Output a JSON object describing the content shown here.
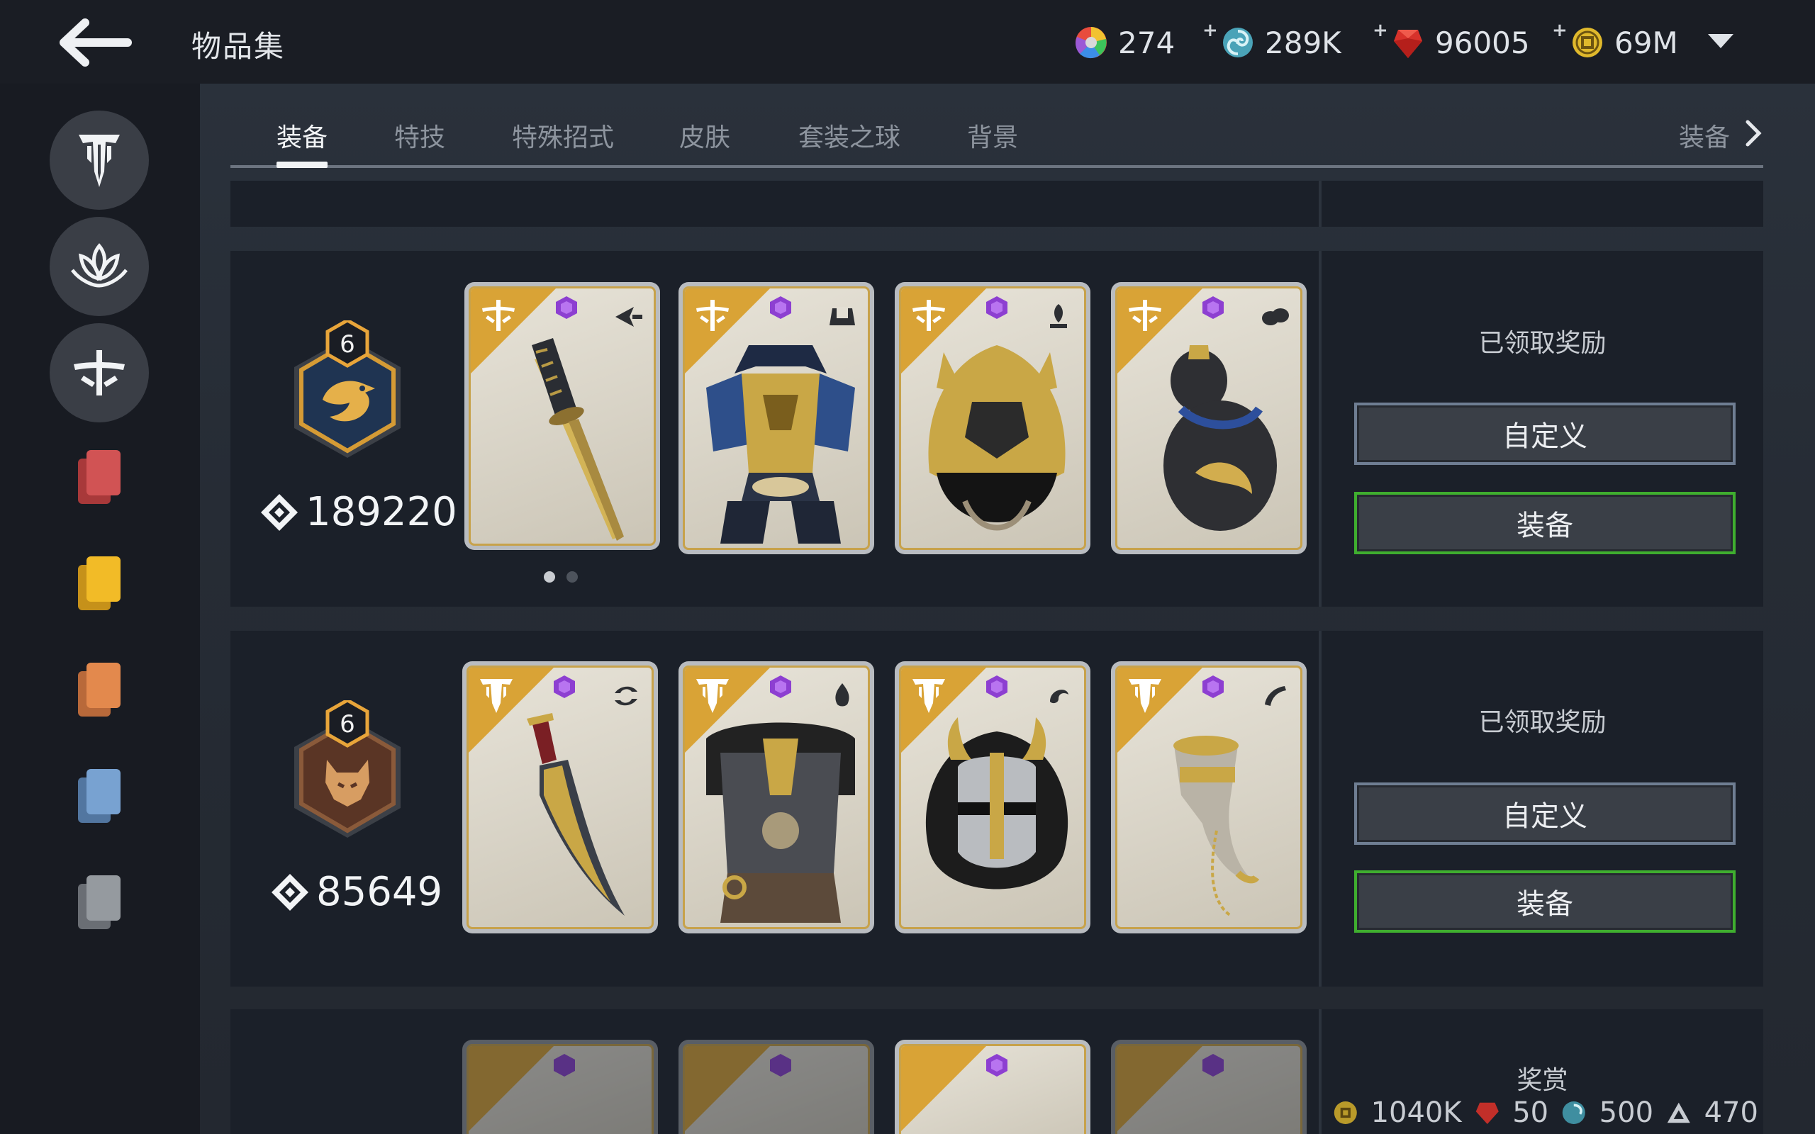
{
  "header": {
    "title": "物品集",
    "currencies": [
      {
        "name": "rainbow-orb",
        "value": "274",
        "has_plus": false
      },
      {
        "name": "steel",
        "value": "289K",
        "has_plus": true
      },
      {
        "name": "ruby",
        "value": "96005",
        "has_plus": true
      },
      {
        "name": "gold-coin",
        "value": "69M",
        "has_plus": true
      }
    ]
  },
  "tabs": [
    {
      "label": "装备",
      "active": true
    },
    {
      "label": "特技",
      "active": false
    },
    {
      "label": "特殊招式",
      "active": false
    },
    {
      "label": "皮肤",
      "active": false
    },
    {
      "label": "套装之球",
      "active": false
    },
    {
      "label": "背景",
      "active": false
    }
  ],
  "tab_right_label": "装备",
  "sidebar": {
    "factions": [
      {
        "icon": "knight-faction-icon",
        "active": false
      },
      {
        "icon": "wu-lin-faction-icon",
        "active": false
      },
      {
        "icon": "samurai-faction-icon",
        "active": true
      }
    ],
    "rarity_colors": [
      "#c94a4a",
      "#e8b21f",
      "#e08444",
      "#6f9ccc",
      "#8b9096"
    ]
  },
  "rows": [
    {
      "level": "6",
      "score": "189220",
      "emblem": "eagle",
      "emblem_color": "#e8a53a",
      "cards": [
        {
          "faction_icon": "samurai-faction-icon",
          "slot_icon": "weapon-slot-icon",
          "art": "katana"
        },
        {
          "faction_icon": "samurai-faction-icon",
          "slot_icon": "chest-slot-icon",
          "art": "armor"
        },
        {
          "faction_icon": "samurai-faction-icon",
          "slot_icon": "helm-slot-icon",
          "art": "kabuto"
        },
        {
          "faction_icon": "samurai-faction-icon",
          "slot_icon": "ornament-slot-icon",
          "art": "gourd"
        }
      ],
      "status": "已领取奖励",
      "customize_label": "自定义",
      "equip_label": "装备"
    },
    {
      "level": "6",
      "score": "85649",
      "emblem": "wolf",
      "emblem_color": "#e8a53a",
      "cards": [
        {
          "faction_icon": "knight-faction-icon",
          "slot_icon": "weapon-slot-icon",
          "art": "dagger"
        },
        {
          "faction_icon": "knight-faction-icon",
          "slot_icon": "chest-slot-icon",
          "art": "fur-armor"
        },
        {
          "faction_icon": "knight-faction-icon",
          "slot_icon": "helm-slot-icon",
          "art": "horned-helm"
        },
        {
          "faction_icon": "knight-faction-icon",
          "slot_icon": "ornament-slot-icon",
          "art": "horn"
        }
      ],
      "status": "已领取奖励",
      "customize_label": "自定义",
      "equip_label": "装备"
    }
  ],
  "partial_row": {
    "reward_title": "奖赏",
    "rewards": [
      {
        "icon": "gold-coin-icon",
        "value": "1040K"
      },
      {
        "icon": "ruby-icon",
        "value": "50"
      },
      {
        "icon": "steel-icon",
        "value": "500"
      },
      {
        "icon": "triangle-shard-icon",
        "value": "470"
      }
    ]
  }
}
